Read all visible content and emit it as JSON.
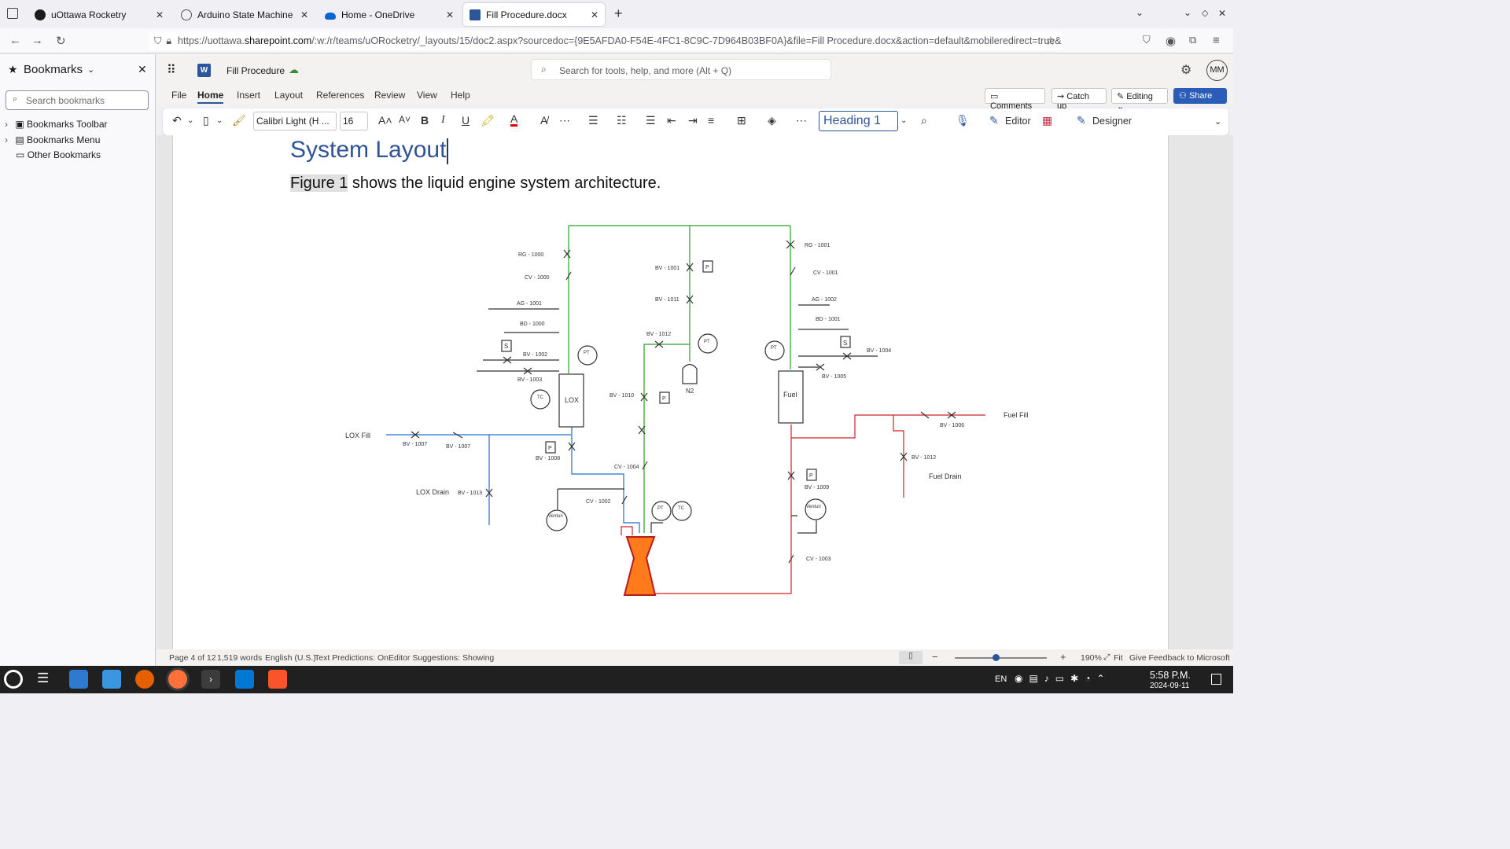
{
  "tabs": [
    {
      "label": "uOttawa Rocketry",
      "icon": "github-icon"
    },
    {
      "label": "Arduino State Machine Rev",
      "icon": "globe-icon"
    },
    {
      "label": "Home - OneDrive",
      "icon": "onedrive-icon"
    },
    {
      "label": "Fill Procedure.docx",
      "icon": "word-icon"
    }
  ],
  "url": {
    "prefix": "https://uottawa.",
    "domain": "sharepoint.com",
    "rest": "/:w:/r/teams/uORocketry/_layouts/15/doc2.aspx?sourcedoc={9E5AFDA0-F54E-4FC1-8C9C-7D964B03BF0A}&file=Fill Procedure.docx&action=default&mobileredirect=true&D"
  },
  "sidebar": {
    "title": "Bookmarks",
    "search_placeholder": "Search bookmarks",
    "items": [
      "Bookmarks Toolbar",
      "Bookmarks Menu",
      "Other Bookmarks"
    ]
  },
  "word": {
    "doc_title": "Fill Procedure",
    "search_placeholder": "Search for tools, help, and more (Alt + Q)",
    "avatar": "MM",
    "menu": [
      "File",
      "Home",
      "Insert",
      "Layout",
      "References",
      "Review",
      "View",
      "Help"
    ],
    "active_menu": "Home",
    "comments": "Comments",
    "catchup": "Catch up",
    "editing": "Editing",
    "share": "Share",
    "font_name": "Calibri Light (H ...",
    "font_size": "16",
    "style": "Heading 1",
    "editor": "Editor",
    "designer": "Designer"
  },
  "document": {
    "heading": "System Layout",
    "figure_ref": "Figure 1",
    "sentence": " shows the liquid engine system architecture."
  },
  "diagram": {
    "labels": {
      "rg1000": "RG - 1000",
      "cv1000": "CV - 1000",
      "ag1001": "AG - 1001",
      "bd1000": "BD - 1000",
      "bv1002": "BV - 1002",
      "bv1003": "BV - 1003",
      "lox": "LOX",
      "tc": "TC",
      "pt": "PT",
      "p": "P",
      "s": "S",
      "bv1001": "BV - 1001",
      "bv1011": "BV - 1011",
      "bv1012": "BV - 1012",
      "n2": "N2",
      "bv1010": "BV - 1010",
      "rg1001": "RG - 1001",
      "cv1001": "CV - 1001",
      "ag1002": "AG - 1002",
      "bd1001": "BD - 1001",
      "bv1004": "BV - 1004",
      "bv1005": "BV - 1005",
      "fuel": "Fuel",
      "loxfill": "LOX Fill",
      "bv1007a": "BV - 1007",
      "bv1007b": "BV - 1007",
      "bv1008": "BV - 1008",
      "cv1004": "CV - 1004",
      "loxdrain": "LOX Drain",
      "bv1013": "BV - 1013",
      "cv1002": "CV - 1002",
      "venturi": "Venturi",
      "fuelfill": "Fuel Fill",
      "bv1006": "BV - 1006",
      "bv1012b": "BV - 1012",
      "fueldrain": "Fuel Drain",
      "bv1009": "BV - 1009",
      "cv1003": "CV - 1003"
    }
  },
  "status": {
    "page": "Page 4 of 12",
    "words": "1,519 words",
    "lang": "English (U.S.)",
    "predictions": "Text Predictions: On",
    "suggestions": "Editor Suggestions: Showing",
    "zoom": "190%",
    "fit": "Fit",
    "feedback": "Give Feedback to Microsoft"
  },
  "taskbar": {
    "lang": "EN",
    "time": "5:58 P.M.",
    "date": "2024-09-11"
  },
  "colors": {
    "lox_line": "#1f6fd0",
    "n2_line": "#2aa02a",
    "fuel_line": "#d42020",
    "engine": "#ff7a1a",
    "word_blue": "#2b579a",
    "heading_blue": "#2f5496"
  }
}
